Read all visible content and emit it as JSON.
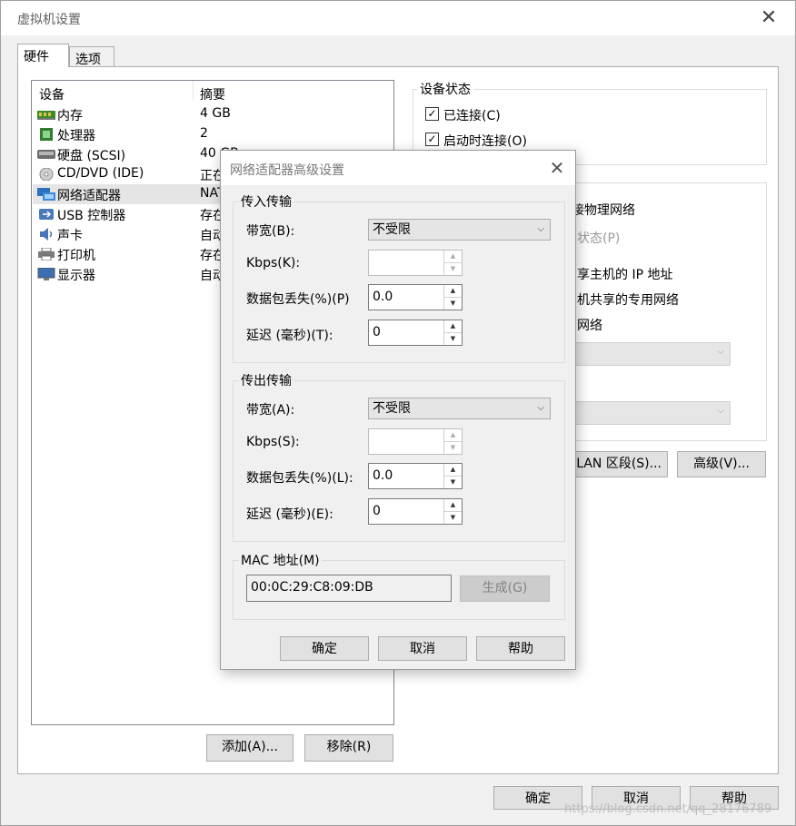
{
  "window": {
    "title": "虚拟机设置"
  },
  "tabs": [
    {
      "label": "硬件"
    },
    {
      "label": "选项"
    }
  ],
  "device_list": {
    "headers": {
      "device": "设备",
      "summary": "摘要"
    },
    "rows": [
      {
        "icon": "memory-icon",
        "name": "内存",
        "summary": "4 GB"
      },
      {
        "icon": "cpu-icon",
        "name": "处理器",
        "summary": "2"
      },
      {
        "icon": "harddisk-icon",
        "name": "硬盘 (SCSI)",
        "summary": "40 GB"
      },
      {
        "icon": "cdrom-icon",
        "name": "CD/DVD (IDE)",
        "summary": "正在"
      },
      {
        "icon": "network-adapter-icon",
        "name": "网络适配器",
        "summary": "NAT"
      },
      {
        "icon": "usb-icon",
        "name": "USB 控制器",
        "summary": "存在"
      },
      {
        "icon": "sound-icon",
        "name": "声卡",
        "summary": "自动"
      },
      {
        "icon": "printer-icon",
        "name": "打印机",
        "summary": "存在"
      },
      {
        "icon": "display-icon",
        "name": "显示器",
        "summary": "自动"
      }
    ],
    "add_label": "添加(A)...",
    "remove_label": "移除(R)"
  },
  "device_status": {
    "label": "设备状态",
    "connected": "已连接(C)",
    "power_on_connect": "启动时连接(O)"
  },
  "network_bg": {
    "bridge_text": "接物理网络",
    "replicate_text": "状态(P)",
    "nat_text": "享主机的 IP 地址",
    "hostonly_text": "机共享的专用网络",
    "custom_text": "网络",
    "lan_segment_label": "LAN 区段(S)...",
    "advanced_label": "高级(V)..."
  },
  "main_buttons": {
    "ok": "确定",
    "cancel": "取消",
    "help": "帮助"
  },
  "watermark": "https://blog.csdn.net/qq_28176789",
  "dialog": {
    "title": "网络适配器高级设置",
    "incoming": {
      "label": "传入传输",
      "bandwidth_label": "带宽(B):",
      "bandwidth_value": "不受限",
      "kbps_label": "Kbps(K):",
      "kbps_value": "",
      "loss_label": "数据包丢失(%)(P)",
      "loss_value": "0.0",
      "latency_label": "延迟 (毫秒)(T):",
      "latency_value": "0"
    },
    "outgoing": {
      "label": "传出传输",
      "bandwidth_label": "带宽(A):",
      "bandwidth_value": "不受限",
      "kbps_label": "Kbps(S):",
      "kbps_value": "",
      "loss_label": "数据包丢失(%)(L):",
      "loss_value": "0.0",
      "latency_label": "延迟 (毫秒)(E):",
      "latency_value": "0"
    },
    "mac": {
      "label": "MAC 地址(M)",
      "value": "00:0C:29:C8:09:DB",
      "generate_label": "生成(G)"
    },
    "buttons": {
      "ok": "确定",
      "cancel": "取消",
      "help": "帮助"
    }
  },
  "colors": {
    "selection": "#e5e5e5",
    "button": "#e1e1e1",
    "dialog_bg": "#f0f0f0"
  }
}
